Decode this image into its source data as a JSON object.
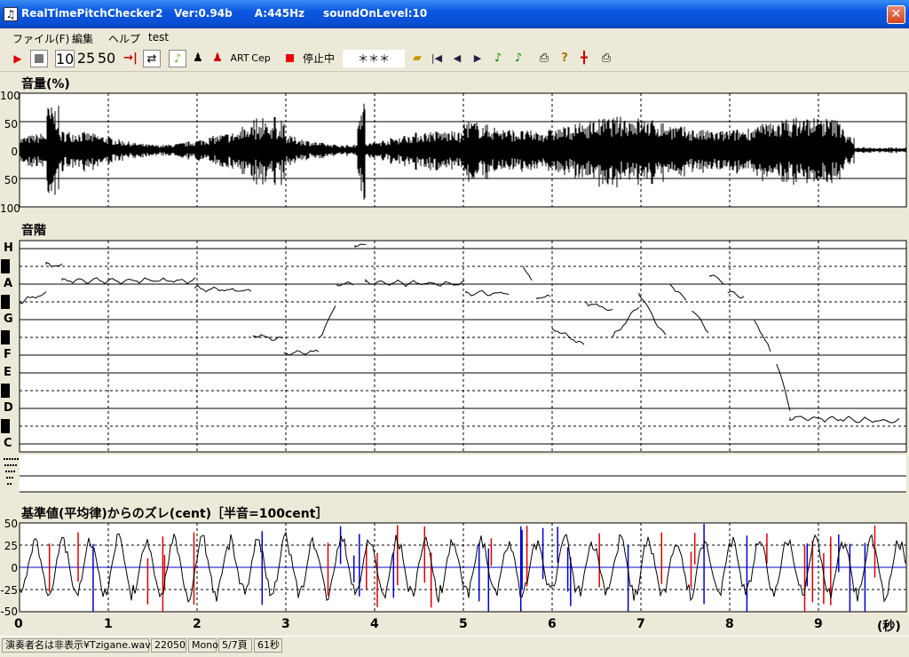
{
  "window": {
    "title": "RealTimePitchChecker2   Ver:0.94b      A:445Hz     soundOnLevel:10",
    "app_icon": "music-note-icon",
    "close_icon": "close-icon"
  },
  "menu": [
    "ファイル(F)",
    "編集",
    "ヘルプ",
    "test"
  ],
  "toolbar": {
    "speed_10": "10",
    "speed_25": "25",
    "speed_50": "50",
    "art_label": "ART",
    "cep_label": "Cep",
    "status_text": "停止中",
    "note_display": "＊＊＊",
    "icons": [
      "play-icon",
      "stop-icon",
      "speed-10-button",
      "speed-25-button",
      "speed-50-button",
      "jump-end-icon",
      "loop-icon",
      "violin-icon",
      "person-dark-icon",
      "person-red-icon",
      "art-button",
      "cep-button",
      "record-icon",
      "folder-open-icon",
      "skip-start-icon",
      "prev-icon",
      "next-icon",
      "note-green-icon",
      "note-green2-icon",
      "print-icon",
      "help-icon",
      "marker-icon",
      "printer-icon"
    ]
  },
  "volume_panel": {
    "title": "音量(%)",
    "y_labels": [
      "100",
      "50",
      "0",
      "50",
      "100"
    ]
  },
  "scale_panel": {
    "title": "音階",
    "notes": [
      "H",
      "A",
      "G",
      "F",
      "E",
      "D",
      "C"
    ]
  },
  "deviation_panel": {
    "title": "基準値(平均律)からのズレ(cent)［半音=100cent］",
    "y_labels": [
      "50",
      "25",
      "0",
      "-25",
      "-50"
    ]
  },
  "time_axis": {
    "ticks": [
      "0",
      "1",
      "2",
      "3",
      "4",
      "5",
      "6",
      "7",
      "8",
      "9"
    ],
    "unit": "(秒)"
  },
  "status_bar": {
    "file": "演奏者名は非表示¥Tzigane.wav",
    "rate": "22050",
    "channel": "Mono",
    "page": "5/7頁",
    "duration": "61秒"
  }
}
